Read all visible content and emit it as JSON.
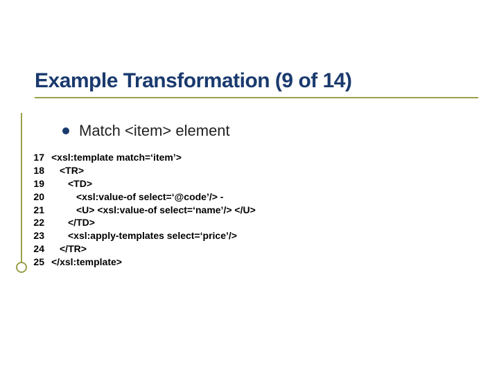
{
  "slide": {
    "title": "Example Transformation (9 of 14)",
    "bullet": "Match <item> element"
  },
  "code": {
    "lines": [
      {
        "n": "17",
        "indent": 0,
        "text": "<xsl:template match=‘item’>"
      },
      {
        "n": "18",
        "indent": 1,
        "text": "<TR>"
      },
      {
        "n": "19",
        "indent": 2,
        "text": "<TD>"
      },
      {
        "n": "20",
        "indent": 3,
        "text": "<xsl:value-of select=‘@code’/> -"
      },
      {
        "n": "21",
        "indent": 3,
        "text": "<U> <xsl:value-of select=‘name’/> </U>"
      },
      {
        "n": "22",
        "indent": 2,
        "text": "</TD>"
      },
      {
        "n": "23",
        "indent": 2,
        "text": "<xsl:apply-templates select=‘price’/>"
      },
      {
        "n": "24",
        "indent": 1,
        "text": "</TR>"
      },
      {
        "n": "25",
        "indent": 0,
        "text": "</xsl:template>"
      }
    ]
  }
}
